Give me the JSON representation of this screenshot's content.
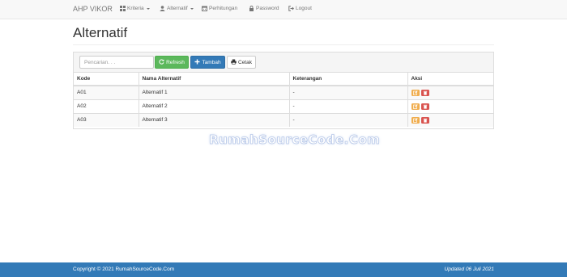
{
  "navbar": {
    "brand": "AHP VIKOR",
    "items": [
      {
        "label": "Kriteria",
        "icon": "grid-icon",
        "dropdown": true
      },
      {
        "label": "Alternatif",
        "icon": "user-icon",
        "dropdown": true
      },
      {
        "label": "Perhitungan",
        "icon": "calendar-icon",
        "dropdown": false
      },
      {
        "label": "Password",
        "icon": "lock-icon",
        "dropdown": false
      },
      {
        "label": "Logout",
        "icon": "logout-icon",
        "dropdown": false
      }
    ]
  },
  "page": {
    "title": "Alternatif"
  },
  "toolbar": {
    "search_placeholder": "Pencarian. . .",
    "search_value": "",
    "refresh_label": "Refresh",
    "tambah_label": "Tambah",
    "cetak_label": "Cetak"
  },
  "table": {
    "headers": [
      "Kode",
      "Nama Alternatif",
      "Keterangan",
      "Aksi"
    ],
    "rows": [
      {
        "kode": "A01",
        "nama": "Alternatif 1",
        "keterangan": "-"
      },
      {
        "kode": "A02",
        "nama": "Alternatif 2",
        "keterangan": "-"
      },
      {
        "kode": "A03",
        "nama": "Alternatif 3",
        "keterangan": "-"
      }
    ]
  },
  "watermark": "RumahSourceCode.Com",
  "footer": {
    "copyright": "Copyright © 2021 RumahSourceCode.Com",
    "updated": "Updated 06 Juli 2021"
  },
  "colors": {
    "navbar_bg": "#f8f8f8",
    "success": "#5cb85c",
    "primary": "#337ab7",
    "warning": "#f0ad4e",
    "danger": "#d9534f",
    "footer_bg": "#337ab7"
  }
}
